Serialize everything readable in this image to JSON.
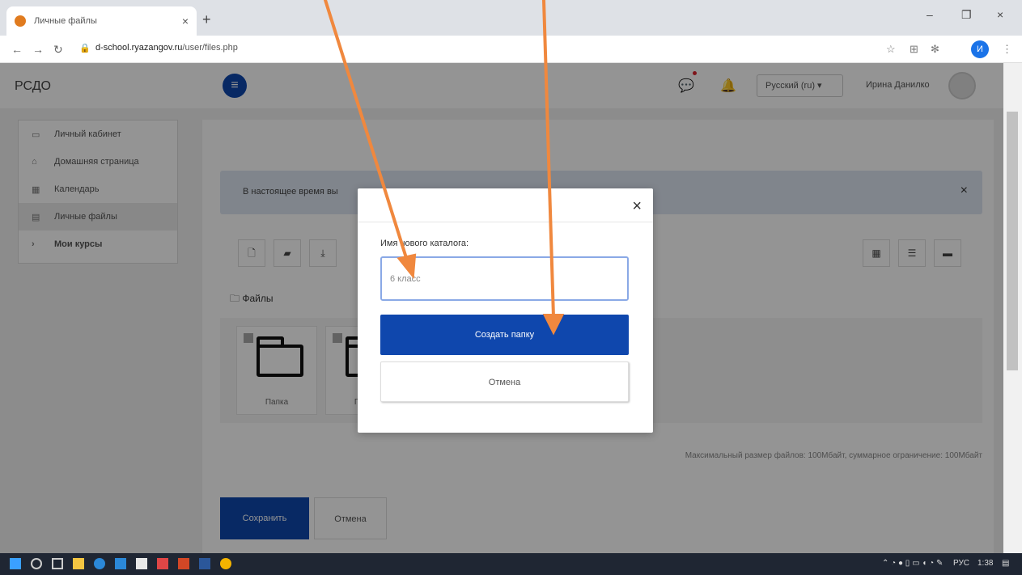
{
  "browser": {
    "tab_title": "Личные файлы",
    "tab_close": "×",
    "new_tab": "+",
    "url_host": "d-school.ryazangov.ru",
    "url_path": "/user/files.php",
    "profile_initial": "И",
    "window_minimize": "–",
    "window_restore": "❐",
    "window_close": "×"
  },
  "navbar": {
    "brand": "РСДО",
    "drawer_icon": "≡",
    "language": "Русский (ru) ▾",
    "user_name": "Ирина Данилко"
  },
  "sidebar": {
    "items": [
      {
        "label": "Личный кабинет",
        "icon": "dashboard-icon"
      },
      {
        "label": "Домашняя страница",
        "icon": "home-icon"
      },
      {
        "label": "Календарь",
        "icon": "calendar-icon"
      },
      {
        "label": "Личные файлы",
        "icon": "files-icon"
      },
      {
        "label": "Мои курсы",
        "icon": "chevron-icon"
      }
    ]
  },
  "main": {
    "alert_text": "В настоящее время вы",
    "alert_close": "×",
    "path_label": "Файлы",
    "folders": [
      "Папка",
      "Папка"
    ],
    "max_info": "Максимальный размер файлов: 100Мбайт, суммарное ограничение: 100Мбайт",
    "save_label": "Сохранить",
    "cancel_label": "Отмена"
  },
  "modal": {
    "close_label": "×",
    "field_label": "Имя нового каталога:",
    "field_value": "6 класс",
    "create_label": "Создать папку",
    "cancel_label": "Отмена"
  },
  "taskbar": {
    "lang": "РУС",
    "time": "1:38"
  },
  "colors": {
    "primary": "#0f47ad",
    "arrow": "#f0883e"
  }
}
